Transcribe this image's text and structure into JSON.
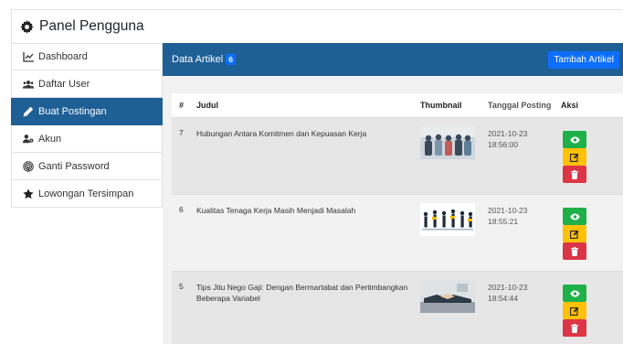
{
  "panel": {
    "title": "Panel Pengguna"
  },
  "sidebar": {
    "items": [
      {
        "label": "Dashboard",
        "icon": "chart-line-icon"
      },
      {
        "label": "Daftar User",
        "icon": "users-icon"
      },
      {
        "label": "Buat Postingan",
        "icon": "pen-icon",
        "active": true
      },
      {
        "label": "Akun",
        "icon": "user-gear-icon"
      },
      {
        "label": "Ganti Password",
        "icon": "fingerprint-icon"
      },
      {
        "label": "Lowongan Tersimpan",
        "icon": "star-icon"
      }
    ]
  },
  "content": {
    "title": "Data Artikel",
    "count": "6",
    "add_button": "Tambah Artikel"
  },
  "table": {
    "headers": {
      "no": "#",
      "judul": "Judul",
      "thumbnail": "Thumbnail",
      "tanggal": "Tanggal Posting",
      "aksi": "Aksi"
    },
    "rows": [
      {
        "no": "7",
        "judul": "Hubungan Antara Komitmen dan Kepuasan Kerja",
        "date": "2021-10-23",
        "time": "18:56:00",
        "thumb": "team-photo"
      },
      {
        "no": "6",
        "judul": "Kualitas Tenaga Kerja Masih Menjadi Masalah",
        "date": "2021-10-23",
        "time": "18:55:21",
        "thumb": "workers-silhouette"
      },
      {
        "no": "5",
        "judul": "Tips Jitu Nego Gaji: Dengan Bermartabat dan Pertimbangkan Beberapa Variabel",
        "date": "2021-10-23",
        "time": "18:54:44",
        "thumb": "handshake-photo"
      }
    ]
  },
  "colors": {
    "primary": "#1e5f96",
    "badge": "#0d6efd",
    "view": "#20b04a",
    "edit": "#ffc107",
    "delete": "#dc3545"
  }
}
